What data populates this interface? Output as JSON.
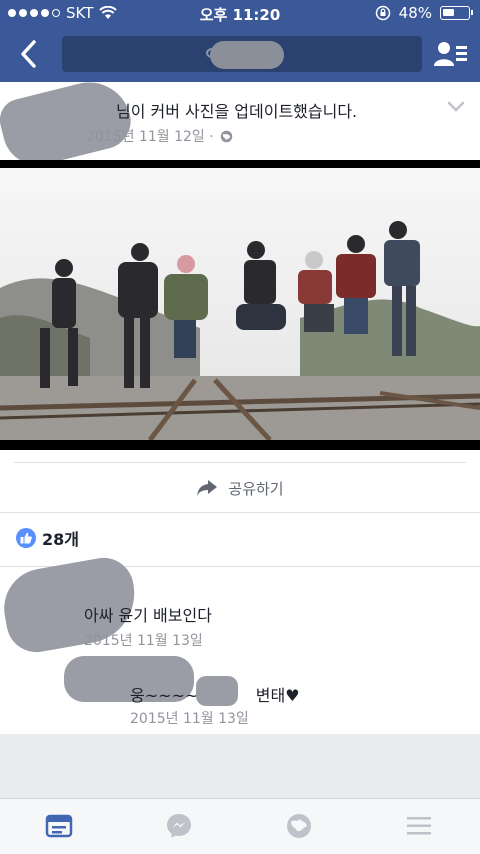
{
  "status_bar": {
    "carrier": "SKT",
    "time": "오후 11:20",
    "battery": "48%",
    "battery_level": 0.48
  },
  "nav": {
    "back_icon": "chevron-left-icon",
    "friends_icon": "friend-list-icon"
  },
  "post": {
    "title": "님이 커버 사진을 업데이트했습니다.",
    "date": "2015년 11월 12일 ·",
    "privacy_icon": "globe-icon",
    "menu_icon": "chevron-down-icon"
  },
  "actions": {
    "share_label": "공유하기"
  },
  "likes": {
    "count_label": "28개"
  },
  "comments": [
    {
      "text": "아싸 윤기 배보인다",
      "date": "2015년 11월 13일"
    },
    {
      "text": "웅~~~~~",
      "suffix": "변태♥",
      "date": "2015년 11월 13일"
    }
  ],
  "tabs": [
    {
      "name": "news-feed",
      "icon": "news-feed-icon",
      "active": true
    },
    {
      "name": "messenger",
      "icon": "messenger-icon",
      "active": false
    },
    {
      "name": "notifications",
      "icon": "globe-icon",
      "active": false
    },
    {
      "name": "menu",
      "icon": "menu-icon",
      "active": false
    }
  ],
  "colors": {
    "brand": "#3b5998",
    "accent": "#4267b2",
    "muted": "#90949c"
  }
}
